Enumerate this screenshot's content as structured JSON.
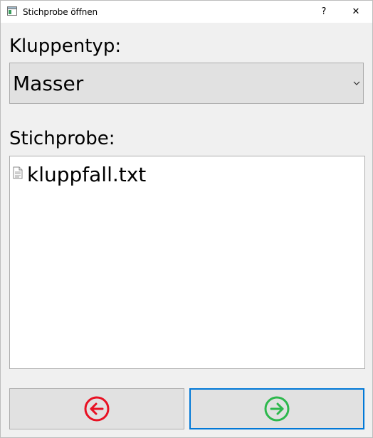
{
  "window": {
    "title": "Stichprobe öffnen",
    "help_glyph": "?",
    "close_glyph": "✕"
  },
  "form": {
    "type_label": "Kluppentyp:",
    "type_value": "Masser",
    "sample_label": "Stichprobe:"
  },
  "sample_list": {
    "items": [
      {
        "label": "kluppfall.txt",
        "icon": "text-file-icon"
      }
    ]
  },
  "buttons": {
    "back": {
      "icon": "arrow-left-circle-icon",
      "color": "#e81123"
    },
    "next": {
      "icon": "arrow-right-circle-icon",
      "color": "#2db84d"
    }
  },
  "colors": {
    "focus_border": "#0078d7",
    "button_bg": "#e1e1e1"
  }
}
